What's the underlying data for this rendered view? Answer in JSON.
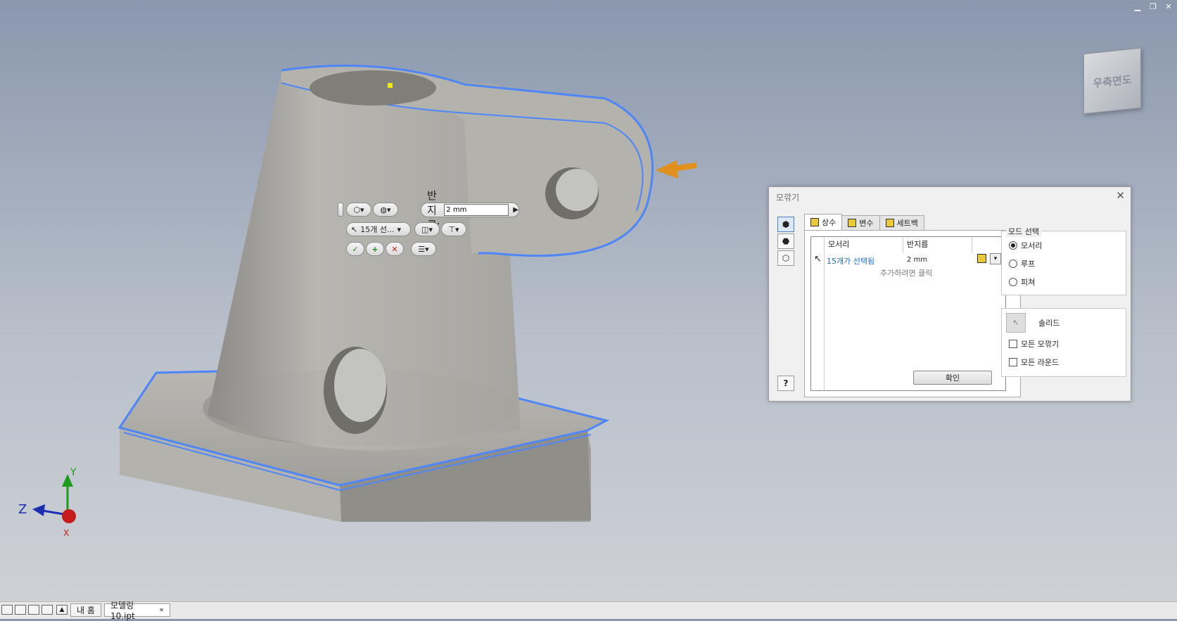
{
  "viewcube": {
    "label": "우측면도"
  },
  "mini_toolbar": {
    "radius_label": "반지름:",
    "radius_value": "2 mm",
    "selection_label": "15개 선...",
    "ok_glyph": "✓",
    "apply_glyph": "+",
    "cancel_glyph": "✕"
  },
  "dialog": {
    "title": "모깎기",
    "tabs": [
      {
        "label": "상수",
        "icon": "fillet-constant-icon"
      },
      {
        "label": "변수",
        "icon": "fillet-variable-icon"
      },
      {
        "label": "세트백",
        "icon": "setback-icon"
      }
    ],
    "table": {
      "col_edges": "모서리",
      "col_radius": "반지름",
      "row_edges": "15개가 선택됨",
      "row_radius": "2 mm",
      "add_hint": "추가하려면 클릭"
    },
    "ok_label": "확인",
    "mode_group": "모드 선택",
    "modes": [
      "모서리",
      "루프",
      "피쳐"
    ],
    "selected_mode": "모서리",
    "solid_label": "솔리드",
    "check_all_fillets": "모든 모깎기",
    "check_all_rounds": "모든 라운드",
    "help_glyph": "?"
  },
  "triad": {
    "x": "X",
    "y": "Y",
    "z": "Z"
  },
  "status_bar": {
    "home_tab": "내 홈",
    "doc_tab": "모델링10.ipt"
  },
  "colors": {
    "highlight": "#4f86f7",
    "part_face": "#a9a8a3",
    "arrow": "#e0901c"
  }
}
